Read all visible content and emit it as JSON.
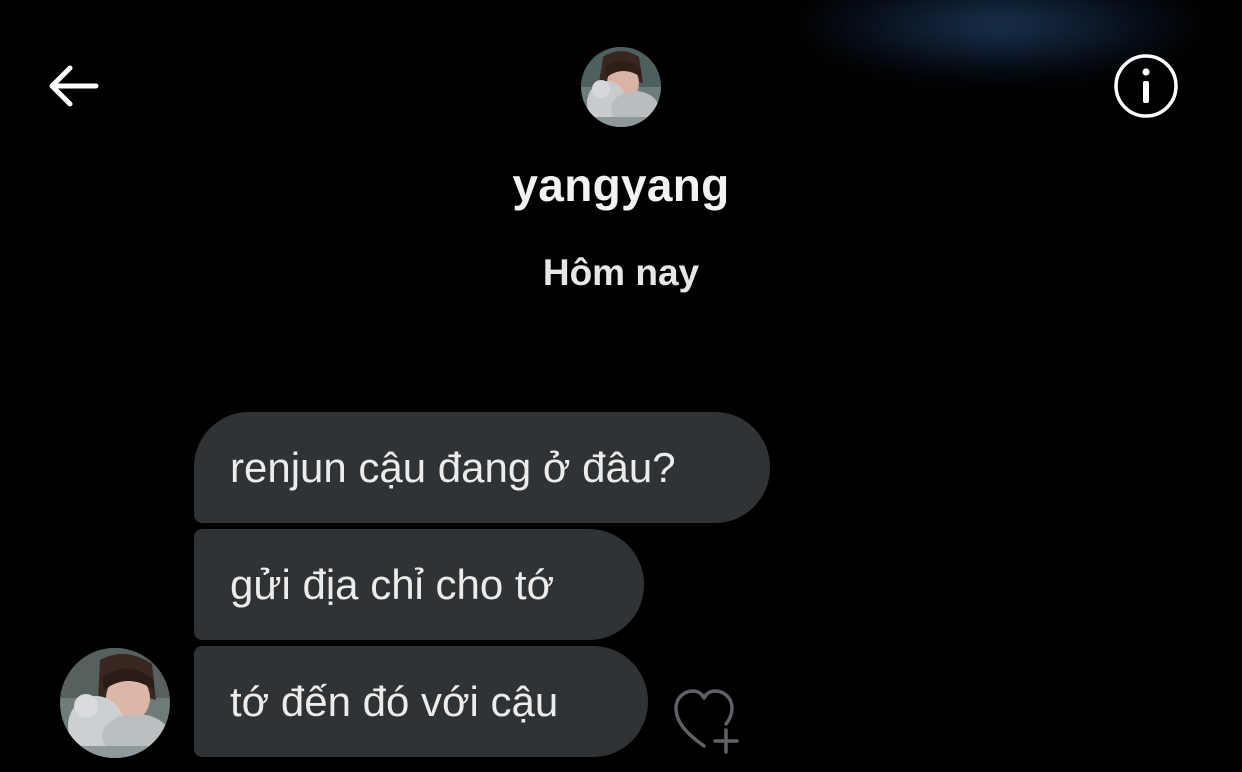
{
  "header": {
    "username": "yangyang",
    "back_icon": "arrow-left-icon",
    "info_icon": "info-icon",
    "avatar_icon": "profile-photo"
  },
  "thread": {
    "day_separator": "Hôm nay",
    "messages": [
      {
        "text": "renjun cậu đang ở đâu?"
      },
      {
        "text": "gửi địa chỉ cho tớ"
      },
      {
        "text": "tớ đến đó với cậu"
      }
    ],
    "react_icon": "heart-plus-icon"
  },
  "colors": {
    "background": "#000000",
    "bubble": "#303335",
    "text": "#ececec",
    "glow": "#24466e"
  }
}
